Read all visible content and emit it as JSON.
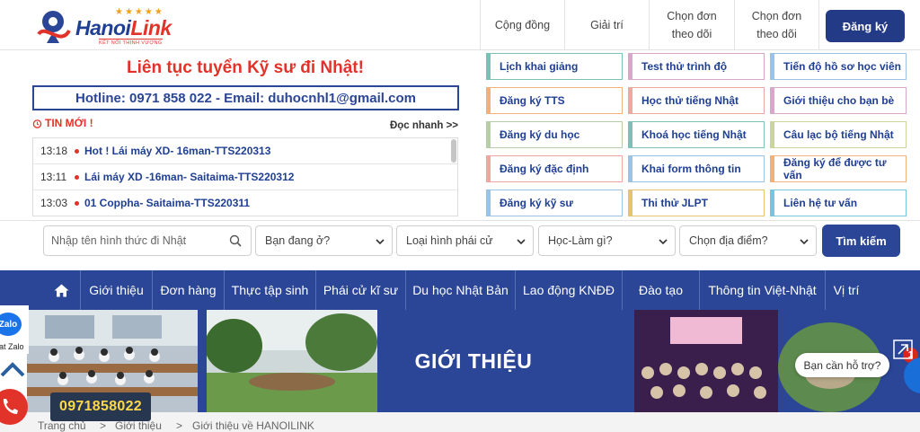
{
  "brand": {
    "name_part1": "Hanoi",
    "name_part2": "Link",
    "stars": "★★★★★",
    "tagline": "KẾT NỐI THỊNH VƯỢNG",
    "colors": {
      "primary": "#2b4597",
      "accent": "#e2332a",
      "gold": "#f0a21a"
    }
  },
  "topnav": {
    "items": [
      {
        "label": "Cộng đồng"
      },
      {
        "label": "Giải trí"
      },
      {
        "label_line1": "Chọn đơn",
        "label_line2": "theo dõi"
      },
      {
        "label_line1": "Chọn đơn",
        "label_line2": "theo dõi"
      }
    ],
    "register": "Đăng ký"
  },
  "promo": {
    "headline": "Liên tục tuyển Kỹ sư đi Nhật!",
    "hotline": "Hotline: 0971 858 022 - Email: duhocnhl1@gmail.com"
  },
  "news": {
    "heading": "TIN MỚI !",
    "read_more": "Đọc nhanh >>",
    "items": [
      {
        "time": "13:18",
        "title": "Hot ! Lái máy XD- 16man-TTS220313"
      },
      {
        "time": "13:11",
        "title": "Lái máy XD -16man- Saitaima-TTS220312"
      },
      {
        "time": "13:03",
        "title": "01 Coppha- Saitaima-TTS220311"
      }
    ]
  },
  "quick_links": [
    {
      "label": "Lịch khai giảng",
      "color": "#7cc0b8"
    },
    {
      "label": "Test thử trình độ",
      "color": "#d7a8c9"
    },
    {
      "label": "Tiến độ hồ sơ học viên",
      "color": "#9cc3e6"
    },
    {
      "label": "Đăng ký TTS",
      "color": "#f2b07a"
    },
    {
      "label": "Học thử tiếng Nhật",
      "color": "#f2a6a0"
    },
    {
      "label": "Giới thiệu cho bạn bè",
      "color": "#d7a8c9"
    },
    {
      "label": "Đăng ký du học",
      "color": "#b7cfa8"
    },
    {
      "label": "Khoá học tiếng Nhật",
      "color": "#7cc0b8"
    },
    {
      "label": "Câu lạc bộ tiếng Nhật",
      "color": "#c9d59a"
    },
    {
      "label": "Đăng ký đặc định",
      "color": "#f2a6a0"
    },
    {
      "label": "Khai form thông tin",
      "color": "#9cc3e6"
    },
    {
      "label": "Đăng ký để được tư vấn",
      "color": "#f2b07a"
    },
    {
      "label": "Đăng ký kỹ sư",
      "color": "#9cc3e6"
    },
    {
      "label": "Thi thử JLPT",
      "color": "#e6c36e"
    },
    {
      "label": "Liên hệ tư vấn",
      "color": "#7ac4dc"
    }
  ],
  "search": {
    "placeholder": "Nhập tên hình thức đi Nhật",
    "selects": [
      {
        "value": "Bạn đang ở?"
      },
      {
        "value": "Loại hình phái cử"
      },
      {
        "value": "Học-Làm gì?"
      },
      {
        "value": "Chọn địa điểm?"
      }
    ],
    "button": "Tìm kiếm"
  },
  "mainnav": {
    "items": [
      {
        "label": "Giới thiệu"
      },
      {
        "label": "Đơn hàng"
      },
      {
        "label": "Thực tập sinh"
      },
      {
        "label": "Phái cử kĩ sư"
      },
      {
        "label": "Du học Nhật Bản"
      },
      {
        "label": "Lao động KNĐĐ"
      },
      {
        "label": "Đào tạo"
      },
      {
        "label": "Thông tin Việt-Nhật"
      },
      {
        "label": "Vị trí"
      }
    ]
  },
  "banner": {
    "title": "GIỚI THIỆU"
  },
  "breadcrumb": {
    "items": [
      {
        "label": "Trang chủ"
      },
      {
        "label": "Giới thiệu"
      },
      {
        "label": "Giới thiệu về HANOILINK"
      }
    ],
    "separator": ">"
  },
  "widgets": {
    "zalo_icon": "Zalo",
    "zalo_label": "at Zalo",
    "phone": "0971858022",
    "help": "Bạn cần hỗ trợ?",
    "help_count": "1"
  }
}
